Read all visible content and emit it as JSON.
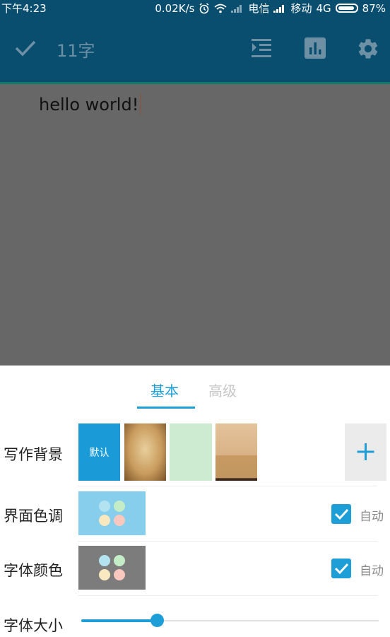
{
  "status_bar": {
    "time": "下午4:23",
    "speed": "0.02K/s",
    "carrier1": "电信",
    "carrier2": "移动",
    "network": "4G",
    "battery": "87%"
  },
  "toolbar": {
    "char_count": "11字",
    "icons": [
      "check-icon",
      "indent-icon",
      "stats-icon",
      "settings-icon"
    ]
  },
  "editor": {
    "text": "hello world!"
  },
  "panel": {
    "tabs": [
      {
        "label": "基本",
        "active": true
      },
      {
        "label": "高级",
        "active": false
      }
    ],
    "background_row": {
      "label": "写作背景",
      "default_label": "默认",
      "swatches": [
        "default",
        "old-paper",
        "light-green",
        "wood"
      ],
      "add_icon": "plus-icon"
    },
    "theme_row": {
      "label": "界面色调",
      "auto_label": "自动",
      "auto_checked": true,
      "box_color": "#87ceed",
      "dots": [
        "#b3e3f0",
        "#c4ecc6",
        "#fae8c0",
        "#f8c7bd"
      ]
    },
    "font_color_row": {
      "label": "字体颜色",
      "auto_label": "自动",
      "auto_checked": true,
      "box_color": "#7c7c7c",
      "dots": [
        "#b3e3f0",
        "#c4ecc6",
        "#fae8c0",
        "#f8c7bd"
      ]
    },
    "font_size_row": {
      "label": "字体大小",
      "slider_value": 0.25
    }
  },
  "colors": {
    "accent": "#1d9ed6",
    "toolbar_bg": "#0a4e6f",
    "editor_bg": "#676767"
  }
}
